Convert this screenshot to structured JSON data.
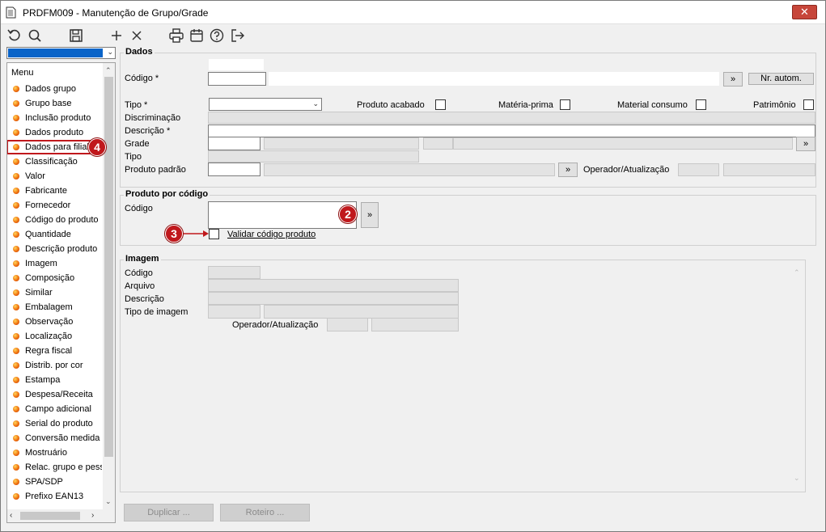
{
  "window": {
    "title": "PRDFM009 - Manutenção de Grupo/Grade",
    "close_label": "✕"
  },
  "toolbar": {
    "items": [
      {
        "name": "refresh-icon"
      },
      {
        "name": "search-icon"
      },
      {
        "name": "save-icon"
      },
      {
        "name": "add-icon"
      },
      {
        "name": "delete-icon"
      },
      {
        "name": "print-icon"
      },
      {
        "name": "calendar-icon"
      },
      {
        "name": "help-icon"
      },
      {
        "name": "exit-icon"
      }
    ]
  },
  "sidebar": {
    "header": "Menu",
    "items": [
      {
        "label": "Dados grupo"
      },
      {
        "label": "Grupo base"
      },
      {
        "label": "Inclusão produto"
      },
      {
        "label": "Dados produto"
      },
      {
        "label": "Dados para filial"
      },
      {
        "label": "Classificação"
      },
      {
        "label": "Valor"
      },
      {
        "label": "Fabricante"
      },
      {
        "label": "Fornecedor"
      },
      {
        "label": "Código do produto"
      },
      {
        "label": "Quantidade"
      },
      {
        "label": "Descrição produto"
      },
      {
        "label": "Imagem"
      },
      {
        "label": "Composição"
      },
      {
        "label": "Similar"
      },
      {
        "label": "Embalagem"
      },
      {
        "label": "Observação"
      },
      {
        "label": "Localização"
      },
      {
        "label": "Regra fiscal"
      },
      {
        "label": "Distrib. por cor"
      },
      {
        "label": "Estampa"
      },
      {
        "label": "Despesa/Receita"
      },
      {
        "label": "Campo adicional"
      },
      {
        "label": "Serial do produto"
      },
      {
        "label": "Conversão medida"
      },
      {
        "label": "Mostruário"
      },
      {
        "label": "Relac. grupo e pess"
      },
      {
        "label": "SPA/SDP"
      },
      {
        "label": "Prefixo EAN13"
      }
    ],
    "active_index": 4
  },
  "dados": {
    "title": "Dados",
    "codigo_label": "Código *",
    "codigo_value": "",
    "more_button": "»",
    "nr_autom_button": "Nr. autom.",
    "tipo_label": "Tipo *",
    "tipo_value": "",
    "produto_acabado_label": "Produto acabado",
    "materia_prima_label": "Matéria-prima",
    "material_consumo_label": "Material consumo",
    "patrimonio_label": "Patrimônio",
    "discriminacao_label": "Discriminação",
    "descricao_label": "Descrição *",
    "grade_label": "Grade",
    "tipo2_label": "Tipo",
    "produto_padrao_label": "Produto padrão",
    "operador_label": "Operador/Atualização"
  },
  "produto_por_codigo": {
    "title": "Produto por código",
    "codigo_label": "Código",
    "codigo_value": "",
    "more_button": "»",
    "validar_label": "Validar código produto",
    "validar_checked": false
  },
  "imagem": {
    "title": "Imagem",
    "codigo_label": "Código",
    "arquivo_label": "Arquivo",
    "descricao_label": "Descrição",
    "tipo_imagem_label": "Tipo de imagem",
    "operador_label": "Operador/Atualização"
  },
  "footer": {
    "duplicar_button": "Duplicar ...",
    "roteiro_button": "Roteiro ..."
  },
  "callouts": [
    "2",
    "3",
    "4"
  ],
  "colors": {
    "accent_red": "#c0181c",
    "selection_blue": "#0a64c8"
  }
}
